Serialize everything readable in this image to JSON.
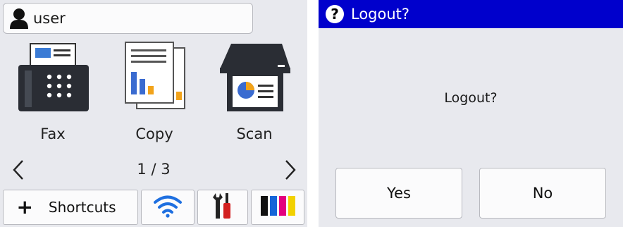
{
  "home": {
    "user": {
      "name": "user",
      "icon": "user-icon"
    },
    "tiles": [
      {
        "label": "Fax",
        "icon": "fax-icon"
      },
      {
        "label": "Copy",
        "icon": "copy-icon"
      },
      {
        "label": "Scan",
        "icon": "scan-icon"
      }
    ],
    "pager": {
      "text": "1 / 3",
      "prev_icon": "chevron-left-icon",
      "next_icon": "chevron-right-icon"
    },
    "bottom": {
      "shortcuts_label": "Shortcuts",
      "shortcuts_icon": "plus-icon",
      "wifi_icon": "wifi-icon",
      "settings_icon": "tools-icon",
      "ink_icon": "ink-icon",
      "ink_colors": [
        "#111111",
        "#1565d8",
        "#e3007f",
        "#f2d100"
      ]
    }
  },
  "dialog": {
    "title": "Logout?",
    "title_icon": "question-icon",
    "title_bar_color": "#0000cc",
    "message": "Logout?",
    "yes_label": "Yes",
    "no_label": "No"
  }
}
